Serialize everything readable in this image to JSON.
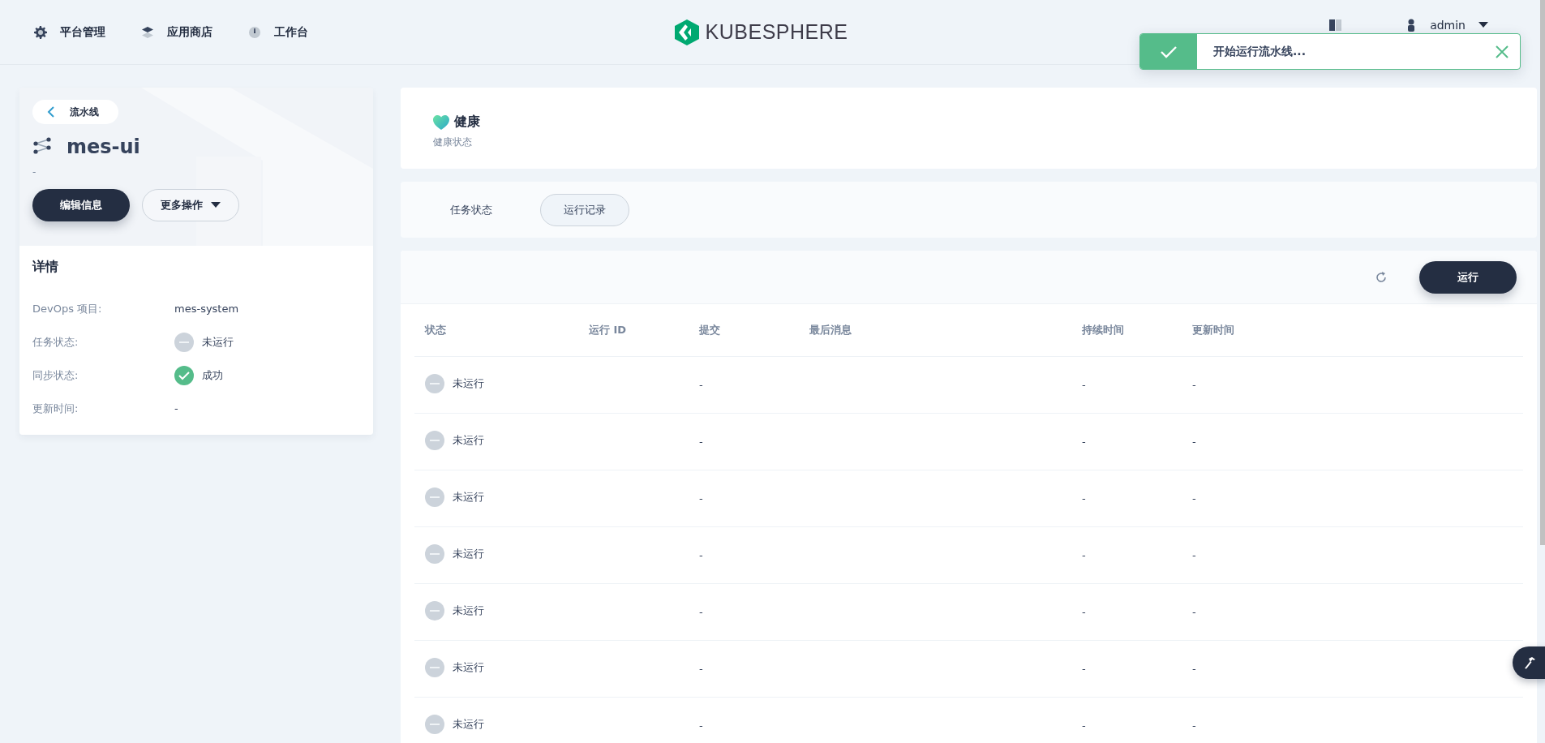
{
  "nav": [
    {
      "label": "平台管理"
    },
    {
      "label": "应用商店"
    },
    {
      "label": "工作台"
    }
  ],
  "logo": {
    "text": "KUBESPHERE"
  },
  "user": {
    "name": "admin"
  },
  "toast": {
    "kind": "success",
    "message": "开始运行流水线..."
  },
  "sidebar": {
    "back_label": "流水线",
    "title": "mes-ui",
    "description": "-",
    "primary_button": "编辑信息",
    "more_button": "更多操作",
    "details_title": "详情",
    "details": [
      {
        "label": "DevOps 项目:",
        "value": "mes-system"
      },
      {
        "label": "任务状态:",
        "value": "未运行",
        "kind": "not-run"
      },
      {
        "label": "同步状态:",
        "value": "成功",
        "kind": "success"
      },
      {
        "label": "更新时间:",
        "value": "-"
      }
    ]
  },
  "health": {
    "title": "健康",
    "subtitle": "健康状态"
  },
  "tabs": [
    {
      "label": "任务状态",
      "selected": false
    },
    {
      "label": "运行记录",
      "selected": true
    }
  ],
  "toolbar": {
    "run_button": "运行"
  },
  "table": {
    "columns": [
      "状态",
      "运行 ID",
      "提交",
      "最后消息",
      "持续时间",
      "更新时间"
    ],
    "rows": [
      {
        "kind": "not-run",
        "status_text": "未运行",
        "commit": "-",
        "duration": "-",
        "updated": "-"
      },
      {
        "kind": "not-run",
        "status_text": "未运行",
        "commit": "-",
        "duration": "-",
        "updated": "-"
      },
      {
        "kind": "not-run",
        "status_text": "未运行",
        "commit": "-",
        "duration": "-",
        "updated": "-"
      },
      {
        "kind": "not-run",
        "status_text": "未运行",
        "commit": "-",
        "duration": "-",
        "updated": "-"
      },
      {
        "kind": "not-run",
        "status_text": "未运行",
        "commit": "-",
        "duration": "-",
        "updated": "-"
      },
      {
        "kind": "not-run",
        "status_text": "未运行",
        "commit": "-",
        "duration": "-",
        "updated": "-"
      },
      {
        "kind": "not-run",
        "status_text": "未运行",
        "commit": "-",
        "duration": "-",
        "updated": "-"
      }
    ]
  }
}
